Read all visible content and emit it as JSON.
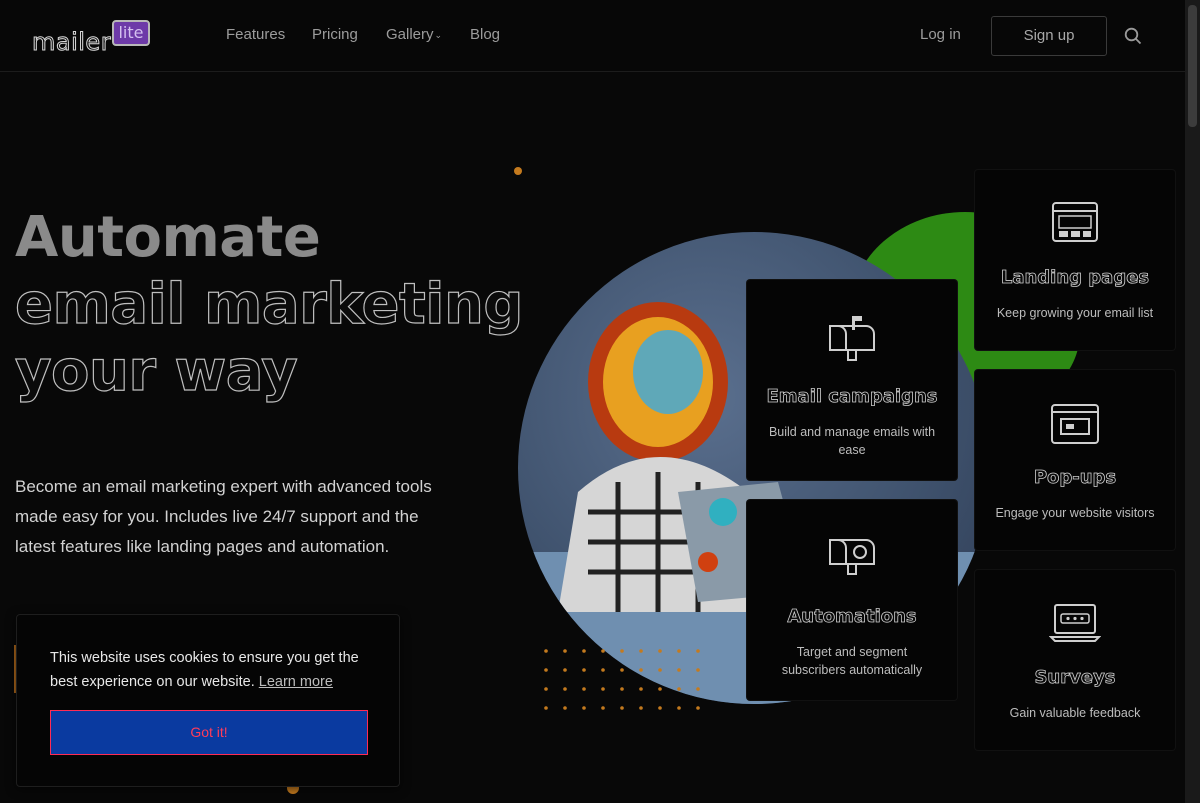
{
  "header": {
    "logo_text": "mailer",
    "logo_badge": "lite",
    "nav": [
      {
        "label": "Features"
      },
      {
        "label": "Pricing"
      },
      {
        "label": "Gallery"
      },
      {
        "label": "Blog"
      }
    ],
    "login_label": "Log in",
    "signup_label": "Sign up",
    "search_icon": "search-icon"
  },
  "hero": {
    "title_line1": "Automate",
    "title_line2": "email marketing",
    "title_line3": "your way",
    "subtitle": "Become an email marketing expert with advanced tools made easy for you. Includes live 24/7 support and the latest features like landing pages and automation."
  },
  "cards": [
    {
      "title": "Email campaigns",
      "desc": "Build and manage emails with ease",
      "icon": "mailbox-icon"
    },
    {
      "title": "Automations",
      "desc": "Target and segment subscribers automatically",
      "icon": "automation-mailbox-icon"
    },
    {
      "title": "Landing pages",
      "desc": "Keep growing your email list",
      "icon": "landing-page-icon"
    },
    {
      "title": "Pop-ups",
      "desc": "Engage your website visitors",
      "icon": "popup-window-icon"
    },
    {
      "title": "Surveys",
      "desc": "Gain valuable feedback",
      "icon": "survey-laptop-icon"
    }
  ],
  "cookie": {
    "text": "This website uses cookies to ensure you get the best experience on our website.",
    "link": "Learn more",
    "button": "Got it!"
  },
  "colors": {
    "background": "#080808",
    "accent_orange": "#c47a1e",
    "green": "#2d8a14",
    "cookie_button": "#0a3aa0"
  }
}
